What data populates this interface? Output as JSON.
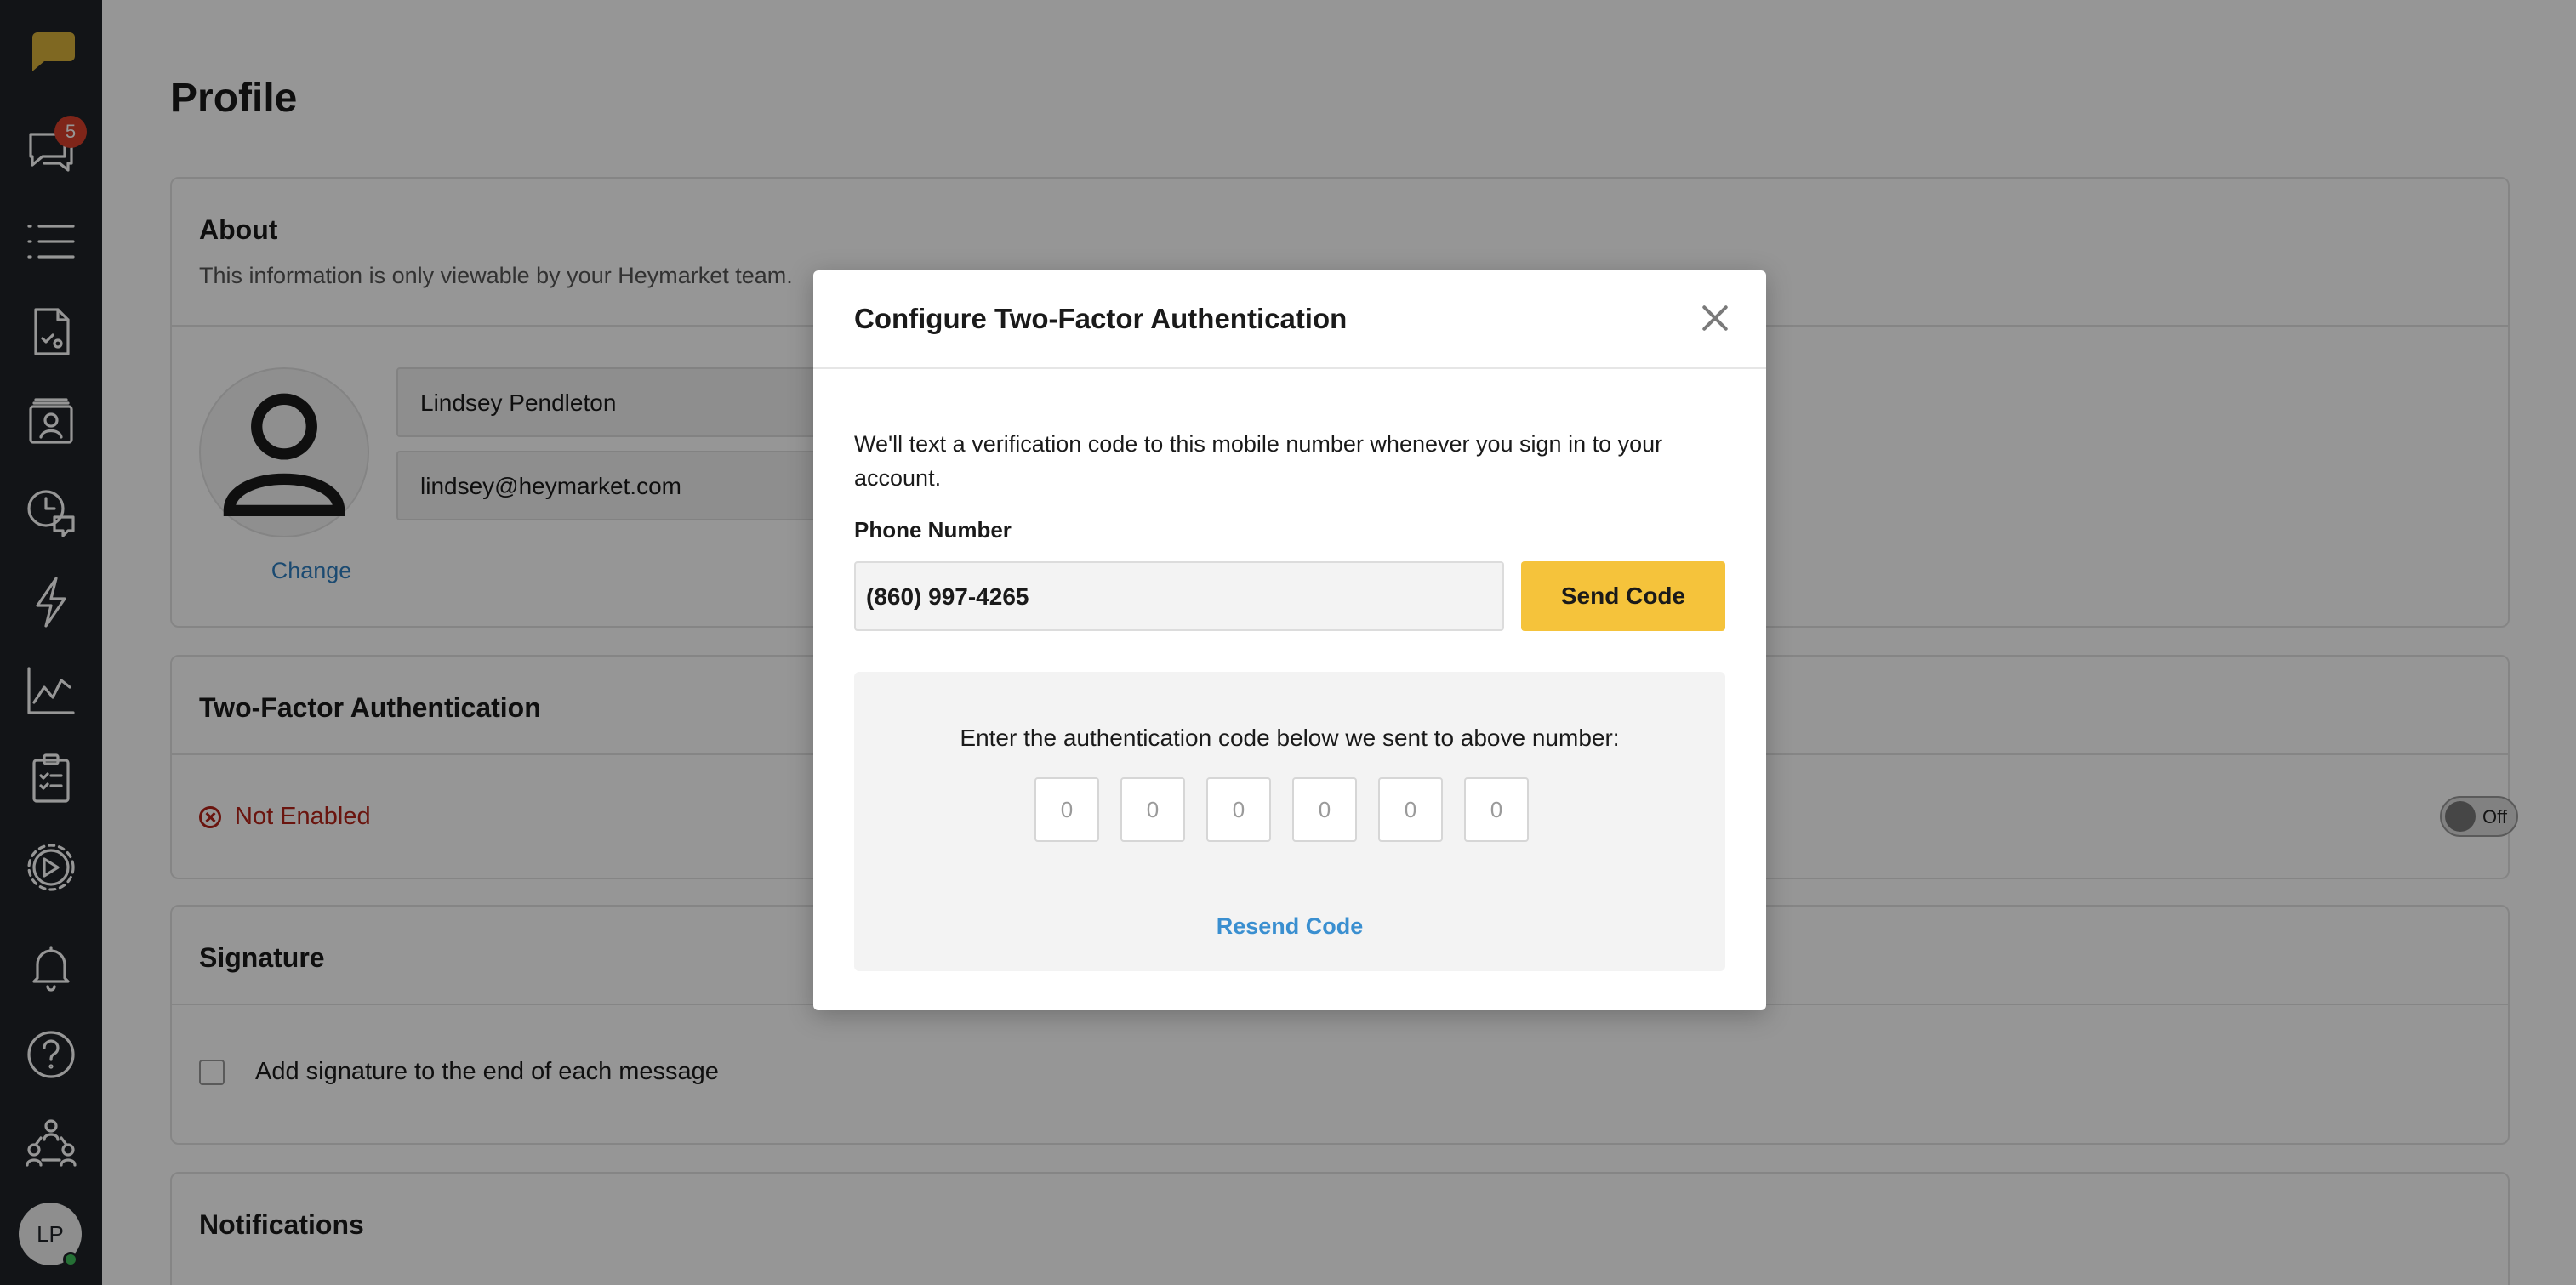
{
  "colors": {
    "sidebar": "#1f2327",
    "accent_yellow": "#f5c33b",
    "link_blue": "#2f7fc1",
    "error_red": "#b42318",
    "badge_red": "#d9402b"
  },
  "sidebar": {
    "items": [
      {
        "icon": "logo-chat-bubble-icon"
      },
      {
        "icon": "chat-bubbles-icon",
        "badge": "5"
      },
      {
        "icon": "list-icon"
      },
      {
        "icon": "document-icon"
      },
      {
        "icon": "contact-card-icon"
      },
      {
        "icon": "clock-chat-icon"
      },
      {
        "icon": "lightning-icon"
      },
      {
        "icon": "chart-icon"
      },
      {
        "icon": "clipboard-icon"
      },
      {
        "icon": "settings-gear-icon"
      },
      {
        "icon": "bell-icon"
      },
      {
        "icon": "help-icon"
      },
      {
        "icon": "team-icon"
      }
    ],
    "avatar_initials": "LP"
  },
  "page": {
    "title": "Profile"
  },
  "about": {
    "title": "About",
    "subtitle": "This information is only viewable by your Heymarket team.",
    "change_link": "Change",
    "name_value": "Lindsey Pendleton",
    "email_value": "lindsey@heymarket.com"
  },
  "two_factor": {
    "title": "Two-Factor Authentication",
    "status": "Not Enabled",
    "toggle_label": "Off"
  },
  "signature": {
    "title": "Signature",
    "checkbox_label": "Add signature to the end of each message"
  },
  "notifications": {
    "title": "Notifications"
  },
  "modal": {
    "title": "Configure Two-Factor Authentication",
    "description": "We'll text a verification code to this mobile number whenever you sign in to your account.",
    "phone_label": "Phone Number",
    "phone_value": "(860) 997-4265",
    "send_button": "Send Code",
    "code_instruction": "Enter the authentication code below we sent to above number:",
    "code_digits": [
      "0",
      "0",
      "0",
      "0",
      "0",
      "0"
    ],
    "resend_link": "Resend Code"
  }
}
